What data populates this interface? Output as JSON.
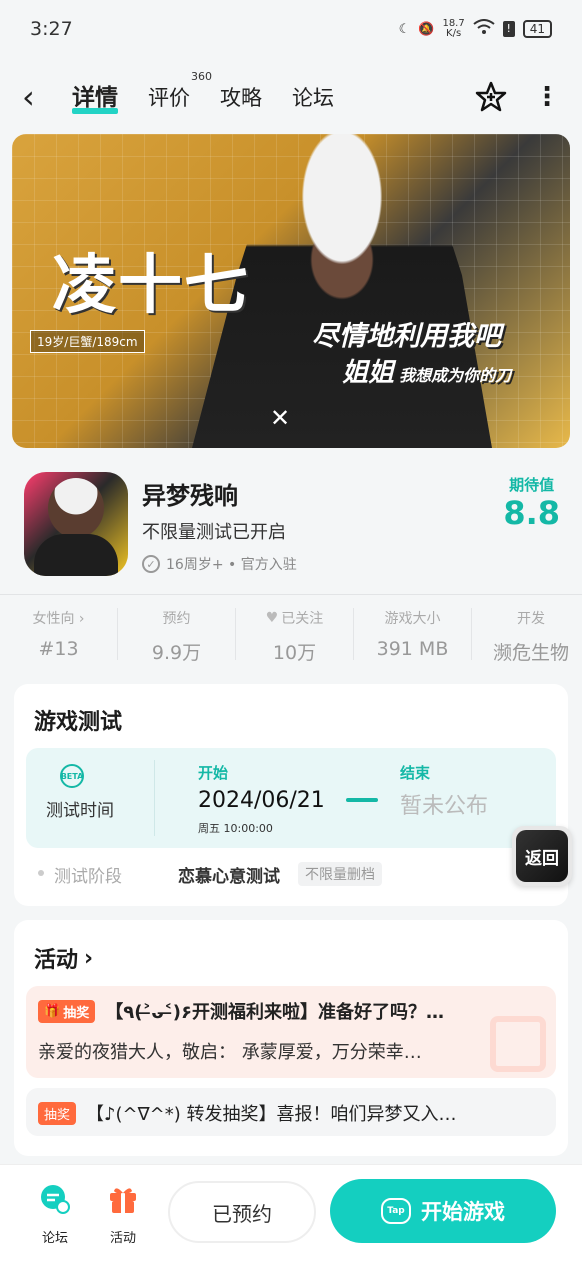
{
  "status_bar": {
    "time": "3:27",
    "net_speed_value": "18.7",
    "net_speed_unit": "K/s",
    "battery": "41"
  },
  "header": {
    "tabs": [
      {
        "label": "详情",
        "active": true
      },
      {
        "label": "评价",
        "count": "360"
      },
      {
        "label": "攻略"
      },
      {
        "label": "论坛"
      }
    ]
  },
  "banner": {
    "name": "凌十七",
    "age_tag": "19岁/巨蟹/189cm",
    "quote_line1": "尽情地利用我吧",
    "quote_line2_big": "姐姐",
    "quote_line2_small": "我想成为你的刀"
  },
  "app": {
    "name": "异梦残响",
    "subtitle": "不限量测试已开启",
    "meta": "16周岁+ • 官方入驻",
    "expect_label": "期待值",
    "expect_value": "8.8"
  },
  "stats": [
    {
      "label": "女性向 ›",
      "value": "#13"
    },
    {
      "label": "预约",
      "value": "9.9万"
    },
    {
      "label": "已关注",
      "value": "10万"
    },
    {
      "label": "游戏大小",
      "value": "391 MB"
    },
    {
      "label": "开发",
      "value": "濒危生物"
    }
  ],
  "game_test": {
    "title": "游戏测试",
    "beta_text": "BETA",
    "time_label": "测试时间",
    "start_label": "开始",
    "start_date": "2024/06/21",
    "start_time": "周五  10:00:00",
    "end_label": "结束",
    "end_value": "暂未公布",
    "stage_label": "测试阶段",
    "stage_value": "恋慕心意测试",
    "stage_tag": "不限量删档"
  },
  "float_back": {
    "label": "返回"
  },
  "activity": {
    "title": "活动",
    "items": [
      {
        "badge": "抽奖",
        "title": "【٩(˃̶ᴗ˂̶)۶开测福利来啦】准备好了吗？…",
        "desc": "亲爱的夜猎大人，敬启：   承蒙厚爱，万分荣幸…"
      },
      {
        "badge": "抽奖",
        "title": "【♪(^∇^*) 转发抽奖】喜报！咱们异梦又入…"
      }
    ]
  },
  "bottom_bar": {
    "forum_label": "论坛",
    "activity_label": "活动",
    "reserved_label": "已预约",
    "play_label": "开始游戏",
    "play_icon_text": "Tap"
  },
  "colors": {
    "accent": "#14cfc0",
    "badge": "#ff6a3d",
    "expect": "#14b8a6"
  }
}
